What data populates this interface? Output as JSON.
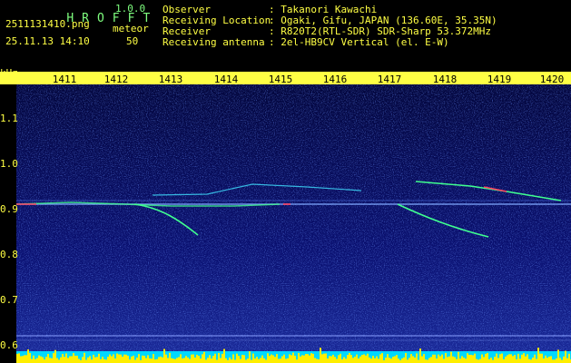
{
  "app": {
    "title_letters": [
      "H",
      "R",
      "O",
      "F",
      "F",
      "T"
    ],
    "version": "1.0.0",
    "file_name": "2511131410.png",
    "datetime": "25.11.13 14:10",
    "meteor_label": "meteor",
    "meteor_count": "50"
  },
  "info": {
    "rows": [
      {
        "key": "Observer",
        "value": ": Takanori Kawachi"
      },
      {
        "key": "Receiving Location",
        "value": ": Ogaki, Gifu, JAPAN (136.60E, 35.35N)"
      },
      {
        "key": "Receiver",
        "value": ": R820T2(RTL-SDR) SDR-Sharp 53.372MHz"
      },
      {
        "key": "Receiving antenna",
        "value": ": 2el-HB9CV Vertical (el. E-W)"
      }
    ]
  },
  "axis": {
    "unit": "kHz",
    "y_ticks": [
      "1.1",
      "1.0",
      "0.9",
      "0.8",
      "0.7",
      "0.6"
    ],
    "x_ticks": [
      "1411",
      "1412",
      "1413",
      "1414",
      "1415",
      "1416",
      "1417",
      "1418",
      "1419",
      "1420"
    ]
  },
  "colors": {
    "background": "#000000",
    "spectrogram": "#0a0f6a",
    "header_text": "#ffff44",
    "title_text": "#7fff7f",
    "trace": "#40ff90",
    "hot": "#ff4060",
    "bottom_bar": "#ffee00",
    "bottom_cyan": "#00d8ff"
  }
}
